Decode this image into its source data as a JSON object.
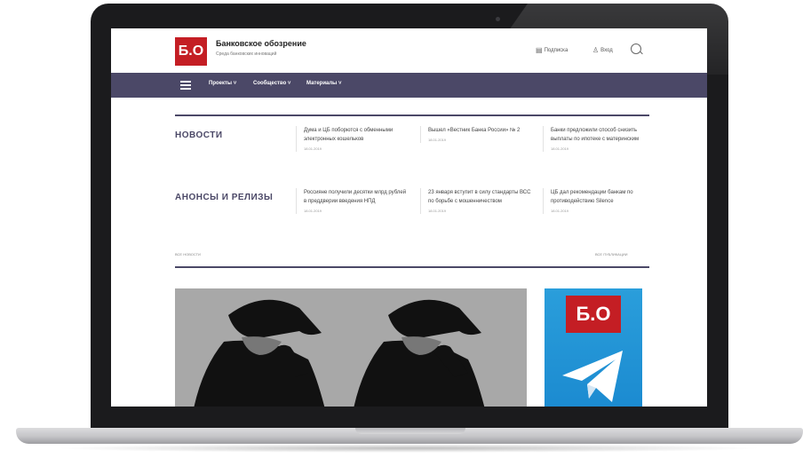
{
  "site": {
    "logo_text": "Б.О",
    "title": "Банковское обозрение",
    "subtitle": "Среда банковских инноваций"
  },
  "header": {
    "subscribe_label": "Подписка",
    "login_label": "Вход",
    "subscribe_icon": "newspaper-icon",
    "login_icon": "user-icon",
    "search_icon": "search-icon"
  },
  "nav": {
    "items": [
      {
        "label": "Проекты ˅"
      },
      {
        "label": "Сообщество ˅"
      },
      {
        "label": "Материалы ˅"
      }
    ]
  },
  "sections": [
    {
      "title": "НОВОСТИ",
      "items": [
        {
          "text": "Дума и ЦБ поборются с обменными электронных кошельков",
          "date": "18.01.2019"
        },
        {
          "text": "Вышел «Вестник Банка России» № 2",
          "date": "18.01.2019"
        },
        {
          "text": "Банки предложили способ снизить выплаты по ипотеке с материнским",
          "date": "18.01.2019"
        }
      ]
    },
    {
      "title": "АНОНСЫ И РЕЛИЗЫ",
      "items": [
        {
          "text": "Россияне получили десятки млрд рублей в преддверии введения НПД",
          "date": "18.01.2019"
        },
        {
          "text": "23 января вступит в силу стандарты ВСС по борьбе с мошенничеством",
          "date": "18.01.2019"
        },
        {
          "text": "ЦБ дал рекомендации банкам по противодействию Silence",
          "date": "18.01.2019"
        }
      ]
    }
  ],
  "links": {
    "all_news": "ВСЕ НОВОСТИ",
    "all_publications": "ВСЕ ПУБЛИКАЦИИ"
  },
  "promo": {
    "logo_text": "Б.О",
    "icon": "telegram-icon"
  },
  "colors": {
    "brand_red": "#c41e24",
    "nav_purple": "#4b4867",
    "telegram_blue": "#2a9edb"
  }
}
